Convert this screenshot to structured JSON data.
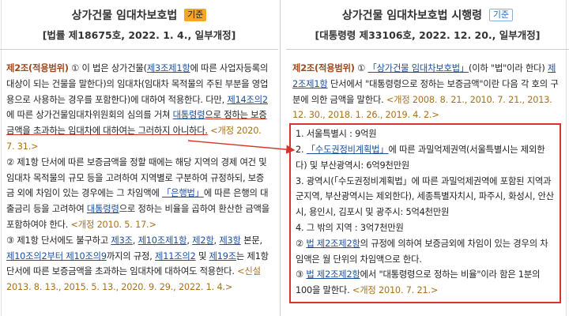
{
  "left": {
    "title": "상가건물 임대차보호법",
    "badge": "기준",
    "subtitle": "[법률 제18675호, 2022. 1. 4., 일부개정]",
    "paragraphs": [
      [
        {
          "t": "제2조(적용범위)",
          "c": "art"
        },
        {
          "t": " ① 이 법은 상가건물("
        },
        {
          "t": "제3조제1항",
          "c": "lnk"
        },
        {
          "t": "에 따른 사업자등록의 대상이 되는 건물을 말한다)의 임대차(임대차 목적물의 주된 부분을 영업용으로 사용하는 경우를 포함한다)에 대하여 적용한다. 다만, "
        },
        {
          "t": "제14조의2",
          "c": "lnk"
        },
        {
          "t": "에 따른 상가건물임대차위원회의 심의를 거쳐 "
        },
        {
          "t": "대통령령",
          "c": "lnk"
        },
        {
          "t": "으로 정하는 보증금액을 초과하는 임대차에 대하여는 그러하지 아니하다.",
          "c": "ul-red"
        },
        {
          "t": " <개정 2020. 7. 31.>",
          "c": "amd"
        }
      ],
      [
        {
          "t": "② 제1항 단서에 따른 보증금액을 정할 때에는 해당 지역의 경제 여건 및 임대차 목적물의 규모 등을 고려하여 지역별로 구분하여 규정하되, 보증금 외에 차임이 있는 경우에는 그 차임액에 "
        },
        {
          "t": "「은행법」",
          "c": "lnk"
        },
        {
          "t": "에 따른 은행의 대출금리 등을 고려하여 "
        },
        {
          "t": "대통령령",
          "c": "lnk"
        },
        {
          "t": "으로 정하는 비율을 곱하여 환산한 금액을 포함하여야 한다."
        },
        {
          "t": " <개정 2010. 5. 17.>",
          "c": "amd"
        }
      ],
      [
        {
          "t": "③ 제1항 단서에도 불구하고 "
        },
        {
          "t": "제3조",
          "c": "lnk"
        },
        {
          "t": ", "
        },
        {
          "t": "제10조제1항",
          "c": "lnk"
        },
        {
          "t": ", "
        },
        {
          "t": "제2항",
          "c": "lnk"
        },
        {
          "t": ", "
        },
        {
          "t": "제3항",
          "c": "lnk"
        },
        {
          "t": " 본문, "
        },
        {
          "t": "제10조의2부터 제10조의9",
          "c": "lnk"
        },
        {
          "t": "까지의 규정, "
        },
        {
          "t": "제11조의2",
          "c": "lnk"
        },
        {
          "t": " 및 "
        },
        {
          "t": "제19조",
          "c": "lnk"
        },
        {
          "t": "는 제1항 단서에 따른 보증금액을 초과하는 임대차에 대하여도 적용한다."
        },
        {
          "t": " <신설 2013. 8. 13., 2015. 5. 13., 2020. 9. 29., 2022. 1. 4.>",
          "c": "amd"
        }
      ]
    ]
  },
  "right": {
    "title": "상가건물 임대차보호법 시행령",
    "badge": "기준",
    "subtitle": "[대통령령 제33106호, 2022. 12. 20., 일부개정]",
    "intro": [
      {
        "t": "제2조(적용범위)",
        "c": "art"
      },
      {
        "t": " ① "
      },
      {
        "t": "「상가건물 임대차보호법」",
        "c": "lnk"
      },
      {
        "t": "(이하 \"법\"이라 한다) "
      },
      {
        "t": "제2조제1항",
        "c": "lnk"
      },
      {
        "t": " 단서에서 \"대통령령으로 정하는 보증금액\"이란 다음 각 호의 구분에 의한 금액을 말한다."
      },
      {
        "t": " <개정 2008. 8. 21., 2010. 7. 21., 2013. 12. 30., 2018. 1. 26., 2019. 4. 2.>",
        "c": "amd"
      }
    ],
    "items": [
      [
        {
          "t": "1. 서울특별시 : 9억원"
        }
      ],
      [
        {
          "t": "2. "
        },
        {
          "t": "「수도권정비계획법」",
          "c": "lnk"
        },
        {
          "t": "에 따른 과밀억제권역(서울특별시는 제외한다) 및 부산광역시: 6억9천만원"
        }
      ],
      [
        {
          "t": "3. 광역시(「수도권정비계획법」에 따른 과밀억제권역에 포함된 지역과 군지역, 부산광역시는 제외한다), 세종특별자치시, 파주시, 화성시, 안산시, 용인시, 김포시 및 광주시: 5억4천만원"
        }
      ],
      [
        {
          "t": "4. 그 밖의 지역 : 3억7천만원"
        }
      ],
      [
        {
          "t": "② "
        },
        {
          "t": "법 제2조제2항",
          "c": "lnk"
        },
        {
          "t": "의 규정에 의하여 보증금외에 차임이 있는 경우의 차임액은 월 단위의 차임액으로 한다."
        }
      ],
      [
        {
          "t": "③ "
        },
        {
          "t": "법 제2조제2항",
          "c": "lnk"
        },
        {
          "t": "에서 \"대통령령으로 정하는 비율\"이라 함은 1분의 100을 말한다."
        },
        {
          "t": " <개정 2010. 7. 21.>",
          "c": "amd"
        }
      ]
    ]
  },
  "colors": {
    "accent_red": "#d9342b",
    "link": "#1d4e9c",
    "article": "#9b4a1d",
    "amendment": "#a8701c",
    "badge_orange": "#f5a623"
  }
}
